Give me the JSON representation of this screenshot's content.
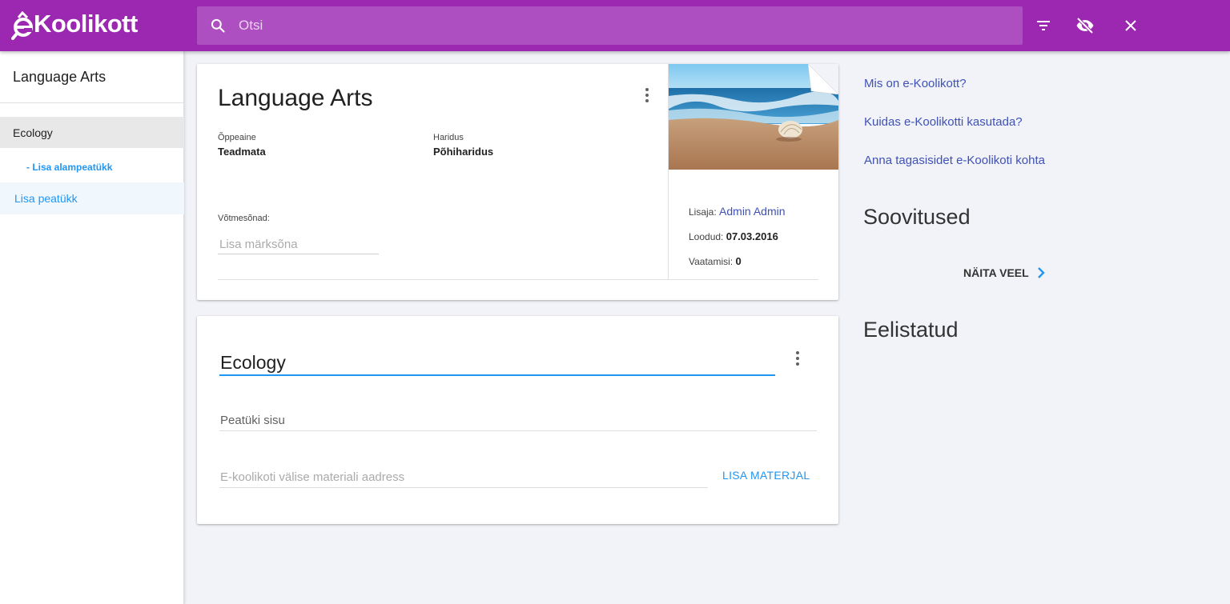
{
  "header": {
    "logo_text": "Koolikott",
    "search_placeholder": "Otsi",
    "icons": [
      "search-icon",
      "filter-icon",
      "visibility-off-icon",
      "close-icon"
    ],
    "colors": {
      "bar": "#9c27b0",
      "search_bg": "#ad4fc0"
    }
  },
  "sidebar": {
    "title": "Language Arts",
    "chapter": "Ecology",
    "add_subchapter": "- Lisa alampeatükk",
    "add_chapter": "Lisa peatükk"
  },
  "portfolio": {
    "title": "Language Arts",
    "subject_label": "Õppeaine",
    "subject_value": "Teadmata",
    "education_label": "Haridus",
    "education_value": "Põhiharidus",
    "keywords_label": "Võtmesõnad:",
    "keyword_placeholder": "Lisa märksõna",
    "added_by_label": "Lisaja:",
    "added_by_value": "Admin Admin",
    "created_label": "Loodud:",
    "created_value": "07.03.2016",
    "views_label": "Vaatamisi:",
    "views_value": "0"
  },
  "chapter_card": {
    "title_value": "Ecology",
    "content_placeholder": "Peatüki sisu",
    "url_placeholder": "E-koolikoti välise materiali aadress",
    "add_material_label": "LISA MATERJAL"
  },
  "right_panel": {
    "links": [
      "Mis on e-Koolikott?",
      "Kuidas e-Koolikotti kasutada?",
      "Anna tagasisidet e-Koolikoti kohta"
    ],
    "recommendations_heading": "Soovitused",
    "show_more_label": "NÄITA VEEL",
    "favorites_heading": "Eelistatud"
  },
  "accent_color": "#2196f3",
  "link_color": "#3f51b5"
}
